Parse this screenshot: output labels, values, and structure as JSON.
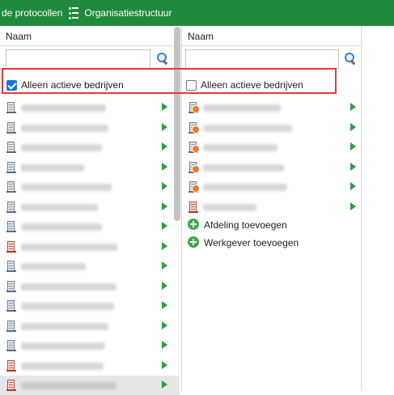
{
  "toolbar": {
    "protocols_label": "de protocollen",
    "org_label": "Organisatiestructuur",
    "org_icon": "org-structure-icon"
  },
  "colors": {
    "header_bg": "#1f8a3b",
    "highlight": "#e53935",
    "arrow": "#2c9f3a",
    "checkbox": "#1a73e8"
  },
  "left_panel": {
    "column_header": "Naam",
    "search": {
      "value": "",
      "placeholder": "",
      "icon": "search-icon"
    },
    "filter": {
      "label": "Alleen actieve bedrijven",
      "checked": true
    },
    "items": [
      {
        "icon": "building-icon"
      },
      {
        "icon": "building-icon"
      },
      {
        "icon": "building-icon"
      },
      {
        "icon": "building-icon"
      },
      {
        "icon": "building-icon"
      },
      {
        "icon": "building-icon"
      },
      {
        "icon": "building-icon"
      },
      {
        "icon": "building-red-icon"
      },
      {
        "icon": "building-icon"
      },
      {
        "icon": "building-icon"
      },
      {
        "icon": "building-icon"
      },
      {
        "icon": "building-icon"
      },
      {
        "icon": "building-icon"
      },
      {
        "icon": "building-red-icon"
      },
      {
        "icon": "building-red-icon",
        "selected": true
      }
    ]
  },
  "right_panel": {
    "column_header": "Naam",
    "search": {
      "value": "",
      "placeholder": "",
      "icon": "search-icon"
    },
    "filter": {
      "label": "Alleen actieve bedrijven",
      "checked": false
    },
    "items": [
      {
        "icon": "building-badge-icon"
      },
      {
        "icon": "building-badge-icon"
      },
      {
        "icon": "building-badge-icon"
      },
      {
        "icon": "building-badge-icon"
      },
      {
        "icon": "building-badge-icon"
      },
      {
        "icon": "building-red-icon"
      }
    ],
    "add_department": "Afdeling toevoegen",
    "add_employer": "Werkgever toevoegen"
  }
}
